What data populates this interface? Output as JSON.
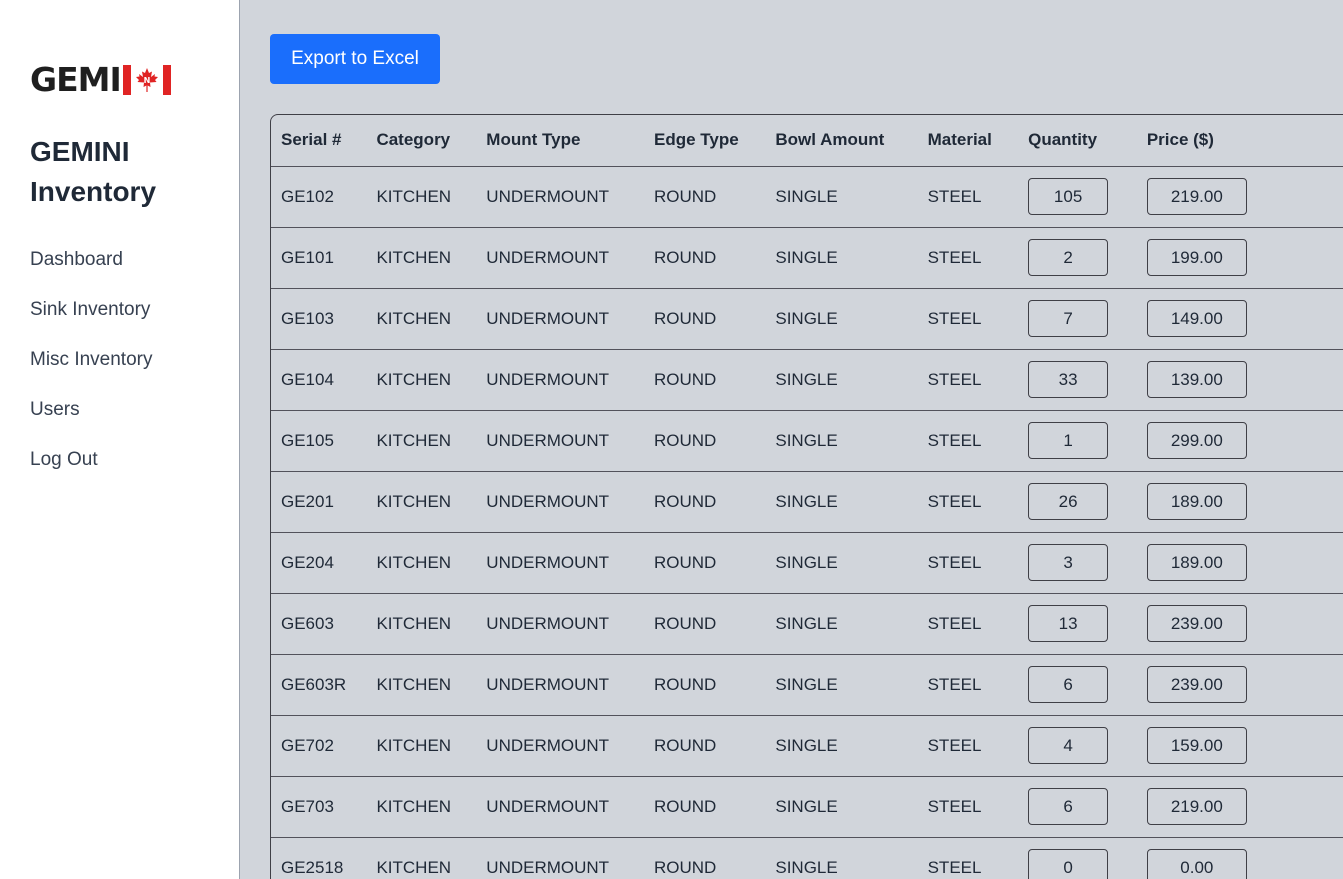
{
  "sidebar": {
    "logo_text": "GEMI",
    "title": "GEMINI Inventory",
    "nav": [
      {
        "label": "Dashboard"
      },
      {
        "label": "Sink Inventory"
      },
      {
        "label": "Misc Inventory"
      },
      {
        "label": "Users"
      },
      {
        "label": "Log Out"
      }
    ]
  },
  "colors": {
    "accent": "#1a6efc",
    "flag_red": "#e02424",
    "page_background": "#d1d5db"
  },
  "toolbar": {
    "export_label": "Export to Excel"
  },
  "table": {
    "headers": [
      "Serial #",
      "Category",
      "Mount Type",
      "Edge Type",
      "Bowl Amount",
      "Material",
      "Quantity",
      "Price ($)"
    ],
    "rows": [
      {
        "serial": "GE102",
        "category": "KITCHEN",
        "mount": "UNDERMOUNT",
        "edge": "ROUND",
        "bowl": "SINGLE",
        "material": "STEEL",
        "quantity": "105",
        "price": "219.00"
      },
      {
        "serial": "GE101",
        "category": "KITCHEN",
        "mount": "UNDERMOUNT",
        "edge": "ROUND",
        "bowl": "SINGLE",
        "material": "STEEL",
        "quantity": "2",
        "price": "199.00"
      },
      {
        "serial": "GE103",
        "category": "KITCHEN",
        "mount": "UNDERMOUNT",
        "edge": "ROUND",
        "bowl": "SINGLE",
        "material": "STEEL",
        "quantity": "7",
        "price": "149.00"
      },
      {
        "serial": "GE104",
        "category": "KITCHEN",
        "mount": "UNDERMOUNT",
        "edge": "ROUND",
        "bowl": "SINGLE",
        "material": "STEEL",
        "quantity": "33",
        "price": "139.00"
      },
      {
        "serial": "GE105",
        "category": "KITCHEN",
        "mount": "UNDERMOUNT",
        "edge": "ROUND",
        "bowl": "SINGLE",
        "material": "STEEL",
        "quantity": "1",
        "price": "299.00"
      },
      {
        "serial": "GE201",
        "category": "KITCHEN",
        "mount": "UNDERMOUNT",
        "edge": "ROUND",
        "bowl": "SINGLE",
        "material": "STEEL",
        "quantity": "26",
        "price": "189.00"
      },
      {
        "serial": "GE204",
        "category": "KITCHEN",
        "mount": "UNDERMOUNT",
        "edge": "ROUND",
        "bowl": "SINGLE",
        "material": "STEEL",
        "quantity": "3",
        "price": "189.00"
      },
      {
        "serial": "GE603",
        "category": "KITCHEN",
        "mount": "UNDERMOUNT",
        "edge": "ROUND",
        "bowl": "SINGLE",
        "material": "STEEL",
        "quantity": "13",
        "price": "239.00"
      },
      {
        "serial": "GE603R",
        "category": "KITCHEN",
        "mount": "UNDERMOUNT",
        "edge": "ROUND",
        "bowl": "SINGLE",
        "material": "STEEL",
        "quantity": "6",
        "price": "239.00"
      },
      {
        "serial": "GE702",
        "category": "KITCHEN",
        "mount": "UNDERMOUNT",
        "edge": "ROUND",
        "bowl": "SINGLE",
        "material": "STEEL",
        "quantity": "4",
        "price": "159.00"
      },
      {
        "serial": "GE703",
        "category": "KITCHEN",
        "mount": "UNDERMOUNT",
        "edge": "ROUND",
        "bowl": "SINGLE",
        "material": "STEEL",
        "quantity": "6",
        "price": "219.00"
      },
      {
        "serial": "GE2518",
        "category": "KITCHEN",
        "mount": "UNDERMOUNT",
        "edge": "ROUND",
        "bowl": "SINGLE",
        "material": "STEEL",
        "quantity": "0",
        "price": "0.00"
      }
    ]
  }
}
